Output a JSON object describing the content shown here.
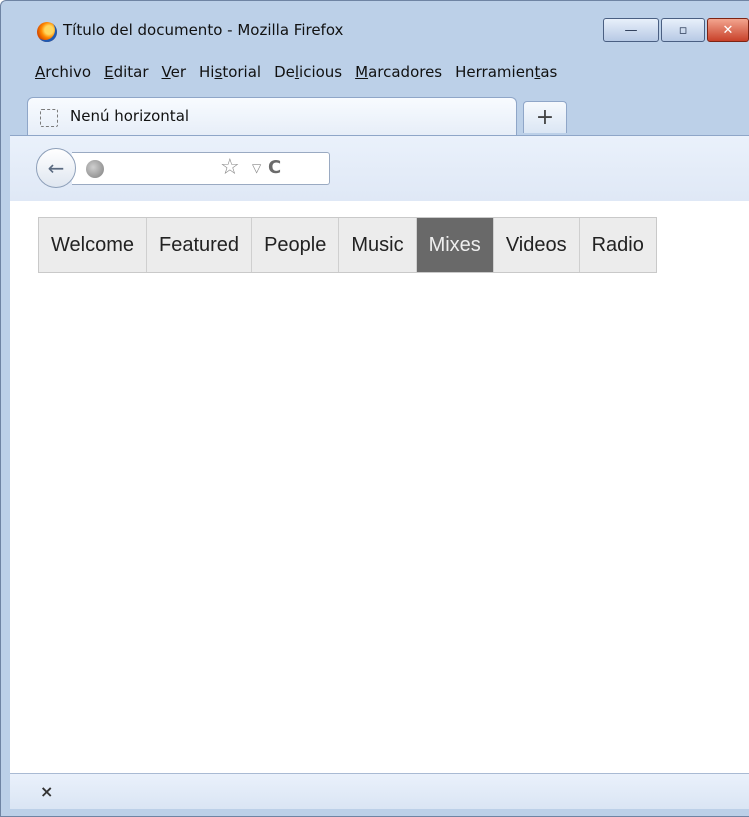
{
  "window": {
    "title": "Título del documento - Mozilla Firefox",
    "controls": {
      "minimize": "—",
      "maximize": "▫",
      "close": "✕"
    }
  },
  "menubar": {
    "items": [
      {
        "pre": "",
        "accel": "A",
        "post": "rchivo"
      },
      {
        "pre": "",
        "accel": "E",
        "post": "ditar"
      },
      {
        "pre": "",
        "accel": "V",
        "post": "er"
      },
      {
        "pre": "Hi",
        "accel": "s",
        "post": "torial"
      },
      {
        "pre": "De",
        "accel": "l",
        "post": "icious"
      },
      {
        "pre": "",
        "accel": "M",
        "post": "arcadores"
      },
      {
        "pre": "Herramien",
        "accel": "t",
        "post": "as"
      }
    ]
  },
  "tabs": {
    "active_label": "Nenú horizontal",
    "new_tab_label": "+"
  },
  "navbar": {
    "back_icon": "←",
    "url_value": "",
    "star_icon": "☆",
    "dropdown_icon": "▽",
    "reload_icon": "C"
  },
  "page_menu": {
    "items": [
      "Welcome",
      "Featured",
      "People",
      "Music",
      "Mixes",
      "Videos",
      "Radio"
    ],
    "active": "Mixes"
  },
  "statusbar": {
    "close_label": "×"
  }
}
